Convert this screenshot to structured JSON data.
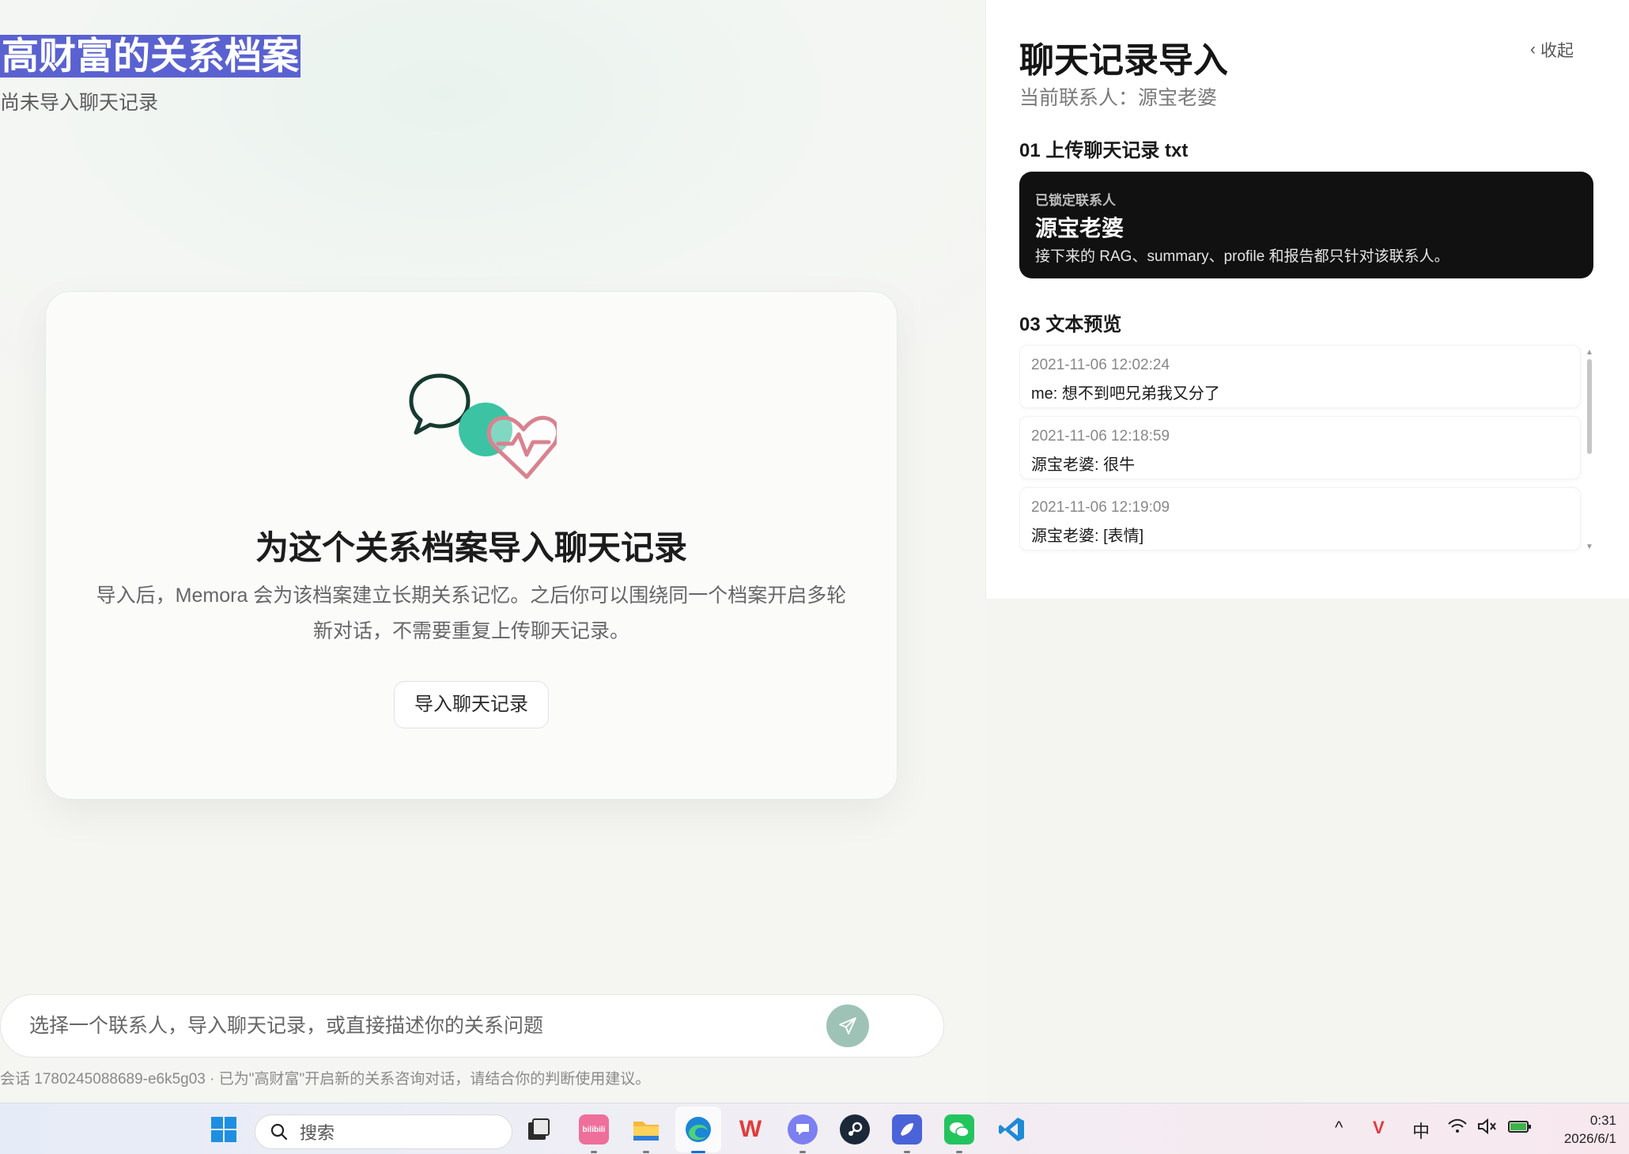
{
  "main": {
    "profile_title": "高财富的关系档案",
    "profile_status": "尚未导入聊天记录",
    "card": {
      "title": "为这个关系档案导入聊天记录",
      "description": "导入后，Memora 会为该档案建立长期关系记忆。之后你可以围绕同一个档案开启多轮新对话，不需要重复上传聊天记录。",
      "button_label": "导入聊天记录",
      "illustration_icons": [
        "speech-bubble-icon",
        "teal-circle",
        "heart-pulse-icon"
      ]
    },
    "composer": {
      "placeholder": "选择一个联系人，导入聊天记录，或直接描述你的关系问题",
      "send_icon": "send-icon"
    },
    "footnote": "会话 1780245088689-e6k5g03 · 已为\"高财富\"开启新的关系咨询对话，请结合你的判断使用建议。"
  },
  "side_panel": {
    "title": "聊天记录导入",
    "collapse_label": "收起",
    "current_contact": "当前联系人：源宝老婆",
    "section_upload": "01 上传聊天记录 txt",
    "locked": {
      "kicker": "已锁定联系人",
      "name": "源宝老婆",
      "note": "接下来的 RAG、summary、profile 和报告都只针对该联系人。"
    },
    "section_preview": "03 文本预览",
    "messages": [
      {
        "time": "2021-11-06 12:02:24",
        "text": "me: 想不到吧兄弟我又分了"
      },
      {
        "time": "2021-11-06 12:18:59",
        "text": "源宝老婆: 很牛"
      },
      {
        "time": "2021-11-06 12:19:09",
        "text": "源宝老婆: [表情]"
      }
    ]
  },
  "taskbar": {
    "search_label": "搜索",
    "apps": [
      "windows-start-icon",
      "file-manager-icon",
      "bilibili-icon",
      "folder-icon",
      "edge-icon",
      "wps-icon",
      "chat-app-icon",
      "steam-icon",
      "rocket-app-icon",
      "wechat-icon",
      "vscode-icon"
    ],
    "bilibili_label": "bilibili",
    "tray": {
      "chevron": "^",
      "ime": "中",
      "time": "0:31",
      "date": "2026/6/1"
    }
  },
  "colors": {
    "accent_teal": "#3cc3a3",
    "heart_pink": "#d9828f",
    "selection_blue": "#5a62d1",
    "send_button": "#9ec3b6"
  }
}
